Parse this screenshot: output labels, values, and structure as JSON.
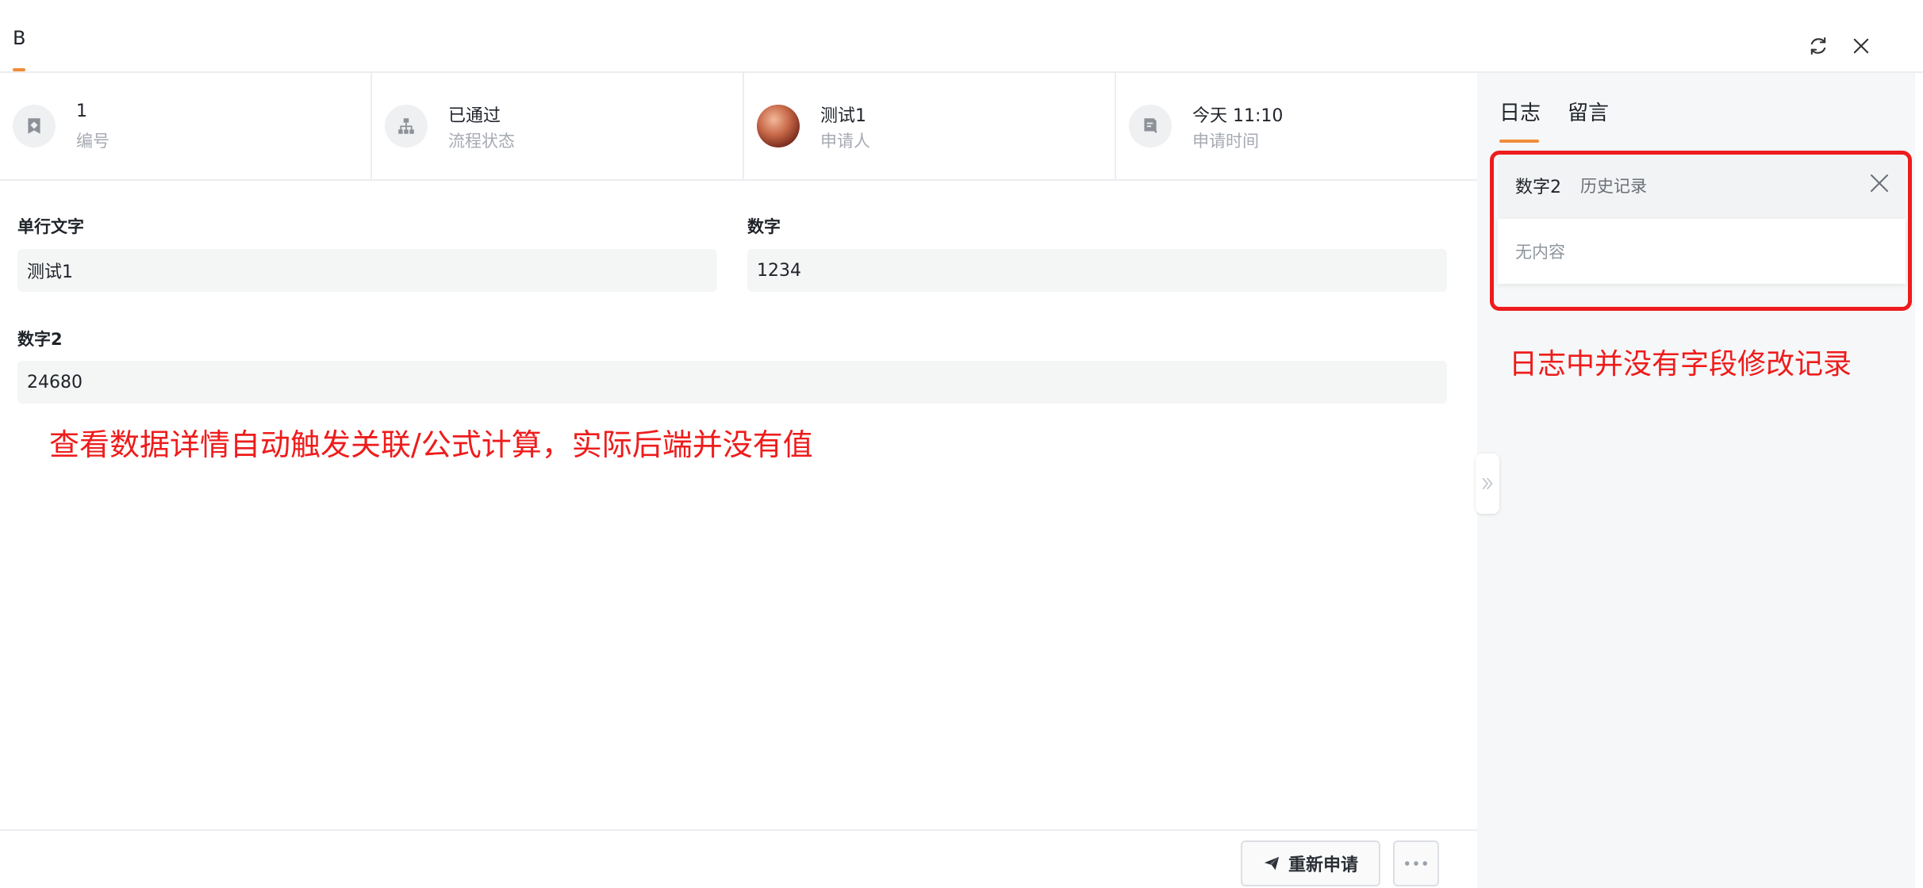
{
  "header": {
    "tab_label": "B"
  },
  "info": [
    {
      "value": "1",
      "label": "编号",
      "icon": "tag-icon"
    },
    {
      "value": "已通过",
      "label": "流程状态",
      "icon": "flow-icon"
    },
    {
      "value": "测试1",
      "label": "申请人",
      "icon": "avatar"
    },
    {
      "value": "今天 11:10",
      "label": "申请时间",
      "icon": "clock-doc-icon"
    }
  ],
  "form": {
    "single_text": {
      "label": "单行文字",
      "value": "测试1"
    },
    "number": {
      "label": "数字",
      "value": "1234"
    },
    "number2": {
      "label": "数字2",
      "value": "24680"
    }
  },
  "annotations": {
    "main": "查看数据详情自动触发关联/公式计算，实际后端并没有值",
    "panel": "日志中并没有字段修改记录"
  },
  "panel": {
    "tabs": [
      "日志",
      "留言"
    ],
    "history": {
      "field": "数字2",
      "subtitle": "历史记录",
      "empty": "无内容"
    }
  },
  "footer": {
    "reapply_label": "重新申请"
  },
  "colors": {
    "accent": "#f08c38",
    "annotation": "#ee1c1c"
  }
}
